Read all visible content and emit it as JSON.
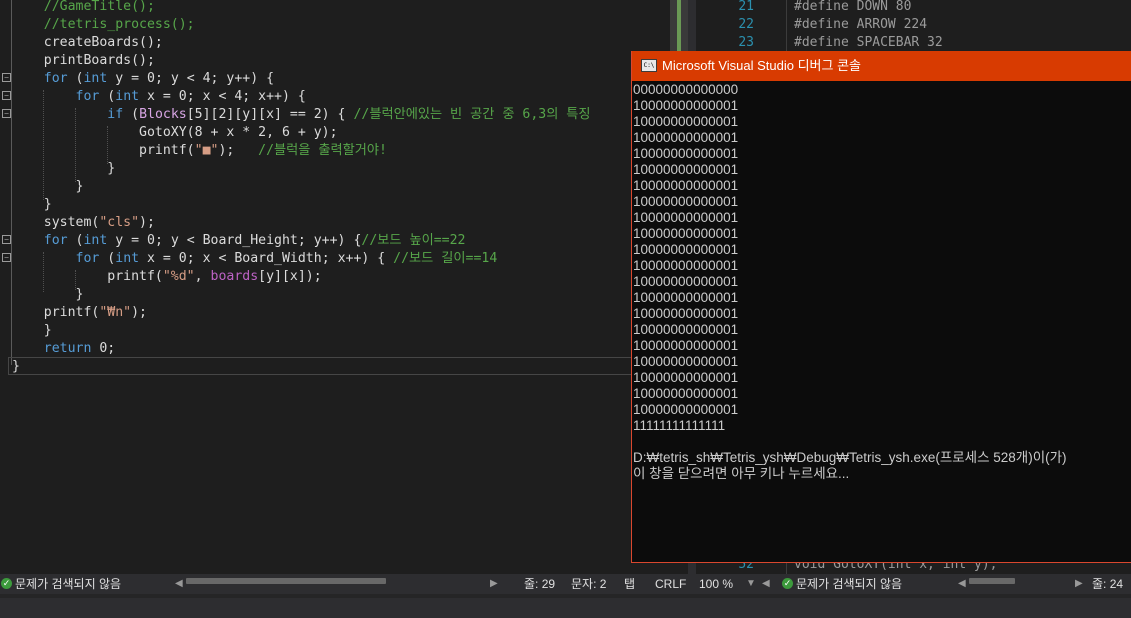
{
  "left_editor": {
    "lines": [
      [
        {
          "t": "    "
        },
        {
          "t": "//GameTitle();",
          "c": "cm"
        }
      ],
      [
        {
          "t": "    "
        },
        {
          "t": "//tetris_process();",
          "c": "cm"
        }
      ],
      [
        {
          "t": "    "
        },
        {
          "t": "createBoards();"
        }
      ],
      [
        {
          "t": "    "
        },
        {
          "t": "printBoards();"
        }
      ],
      [
        {
          "t": "    "
        },
        {
          "t": "for",
          "c": "kw"
        },
        {
          "t": " ("
        },
        {
          "t": "int",
          "c": "kw"
        },
        {
          "t": " y = 0; y < 4; y++) {"
        }
      ],
      [
        {
          "t": "        "
        },
        {
          "t": "for",
          "c": "kw"
        },
        {
          "t": " ("
        },
        {
          "t": "int",
          "c": "kw"
        },
        {
          "t": " x = 0; x < 4; x++) {"
        }
      ],
      [
        {
          "t": "            "
        },
        {
          "t": "if",
          "c": "kw"
        },
        {
          "t": " ("
        },
        {
          "t": "Blocks",
          "c": "mg"
        },
        {
          "t": "[5][2][y][x] == 2) { "
        },
        {
          "t": "//블럭안에있는 빈 공간 중 6,3의 특징",
          "c": "cm"
        }
      ],
      [
        {
          "t": "                "
        },
        {
          "t": "GotoXY(8 + x * 2, 6 + y);"
        }
      ],
      [
        {
          "t": "                "
        },
        {
          "t": "printf("
        },
        {
          "t": "\"■\"",
          "c": "st"
        },
        {
          "t": ");   "
        },
        {
          "t": "//블럭을 출력할거야!",
          "c": "cm"
        }
      ],
      [
        {
          "t": "            "
        },
        {
          "t": "}"
        }
      ],
      [
        {
          "t": "        "
        },
        {
          "t": "}"
        }
      ],
      [
        {
          "t": "    "
        },
        {
          "t": "}"
        }
      ],
      [
        {
          "t": "    "
        },
        {
          "t": "system("
        },
        {
          "t": "\"cls\"",
          "c": "st"
        },
        {
          "t": ");"
        }
      ],
      [
        {
          "t": "    "
        },
        {
          "t": "for",
          "c": "kw"
        },
        {
          "t": " ("
        },
        {
          "t": "int",
          "c": "kw"
        },
        {
          "t": " y = 0; y < Board_Height; y++) {"
        },
        {
          "t": "//보드 높이==22",
          "c": "cm"
        }
      ],
      [
        {
          "t": "        "
        },
        {
          "t": "for",
          "c": "kw"
        },
        {
          "t": " ("
        },
        {
          "t": "int",
          "c": "kw"
        },
        {
          "t": " x = 0; x < Board_Width; x++) { "
        },
        {
          "t": "//보드 길이==14",
          "c": "cm"
        }
      ],
      [
        {
          "t": "            "
        },
        {
          "t": "printf("
        },
        {
          "t": "\"%d\"",
          "c": "st"
        },
        {
          "t": ", "
        },
        {
          "t": "boards",
          "c": "mc"
        },
        {
          "t": "[y][x]);"
        }
      ],
      [
        {
          "t": "        "
        },
        {
          "t": "}"
        }
      ],
      [
        {
          "t": "    "
        },
        {
          "t": "printf("
        },
        {
          "t": "\"₩n\"",
          "c": "st"
        },
        {
          "t": ");"
        }
      ],
      [
        {
          "t": "    "
        },
        {
          "t": "}"
        }
      ],
      [
        {
          "t": "    "
        },
        {
          "t": "return",
          "c": "kw"
        },
        {
          "t": " 0;"
        }
      ],
      [
        {
          "t": "}"
        }
      ]
    ]
  },
  "right_editor": {
    "lines": [
      {
        "num": "21",
        "code": "#define DOWN 80"
      },
      {
        "num": "22",
        "code": "#define ARROW 224"
      },
      {
        "num": "23",
        "code": "#define SPACEBAR 32"
      }
    ],
    "bottom_line": {
      "num": "52",
      "code": "void GotoXY(int x, int y);"
    }
  },
  "console": {
    "title": "Microsoft Visual Studio 디버그 콘솔",
    "icon_text": "C:\\",
    "rows": [
      "00000000000000",
      "10000000000001",
      "10000000000001",
      "10000000000001",
      "10000000000001",
      "10000000000001",
      "10000000000001",
      "10000000000001",
      "10000000000001",
      "10000000000001",
      "10000000000001",
      "10000000000001",
      "10000000000001",
      "10000000000001",
      "10000000000001",
      "10000000000001",
      "10000000000001",
      "10000000000001",
      "10000000000001",
      "10000000000001",
      "10000000000001",
      "11111111111111",
      "",
      "D:₩tetris_sh₩Tetris_ysh₩Debug₩Tetris_ysh.exe(프로세스 528개)이(가)",
      "이 창을 닫으려면 아무 키나 누르세요..."
    ]
  },
  "statusbar": {
    "left_status": "문제가 검색되지 않음",
    "line": "줄: 29",
    "col": "문자: 2",
    "tab": "탭",
    "eol": "CRLF",
    "zoom": "100 %",
    "right_status": "문제가 검색되지 않음",
    "right_line": "줄: 24"
  },
  "colors": {
    "console_title_bar": "#d83b01",
    "editor_bg": "#1e1e1e",
    "keyword": "#569cd6",
    "comment": "#57a64a",
    "string": "#d69d85"
  }
}
